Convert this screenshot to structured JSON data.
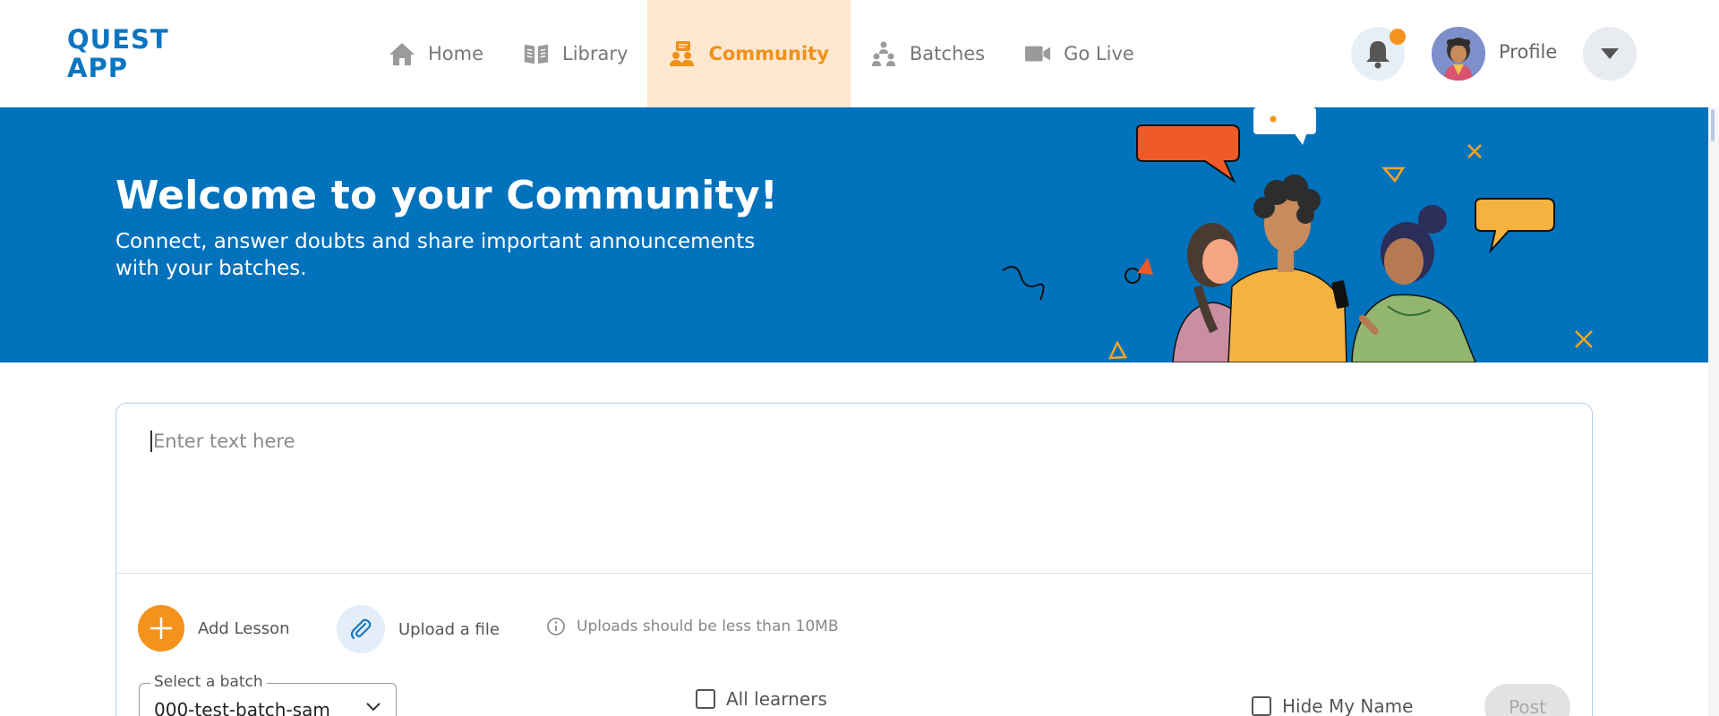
{
  "app": {
    "logo_line1": "QUEST",
    "logo_line2": "APP"
  },
  "nav": {
    "items": [
      {
        "label": "Home",
        "icon": "home-icon",
        "active": false
      },
      {
        "label": "Library",
        "icon": "book-icon",
        "active": false
      },
      {
        "label": "Community",
        "icon": "community-icon",
        "active": true
      },
      {
        "label": "Batches",
        "icon": "batches-icon",
        "active": false
      },
      {
        "label": "Go Live",
        "icon": "video-camera-icon",
        "active": false
      }
    ]
  },
  "header": {
    "notifications_icon": "bell-icon",
    "has_unread": true,
    "profile_label": "Profile",
    "dropdown_icon": "caret-down-icon"
  },
  "banner": {
    "title": "Welcome to your Community!",
    "subtitle": "Connect, answer doubts and share important announcements with your batches."
  },
  "composer": {
    "placeholder": "Enter text here",
    "add_lesson_label": "Add Lesson",
    "upload_label": "Upload a file",
    "upload_note": "Uploads should be less than 10MB",
    "batch_select_label": "Select a batch",
    "batch_select_value": "000-test-batch-sam",
    "all_learners_label": "All learners",
    "hide_name_label": "Hide My Name",
    "post_label": "Post"
  },
  "colors": {
    "brand_blue": "#0172bb",
    "accent_orange": "#f5921c",
    "active_tab_bg": "#fde7cf"
  }
}
